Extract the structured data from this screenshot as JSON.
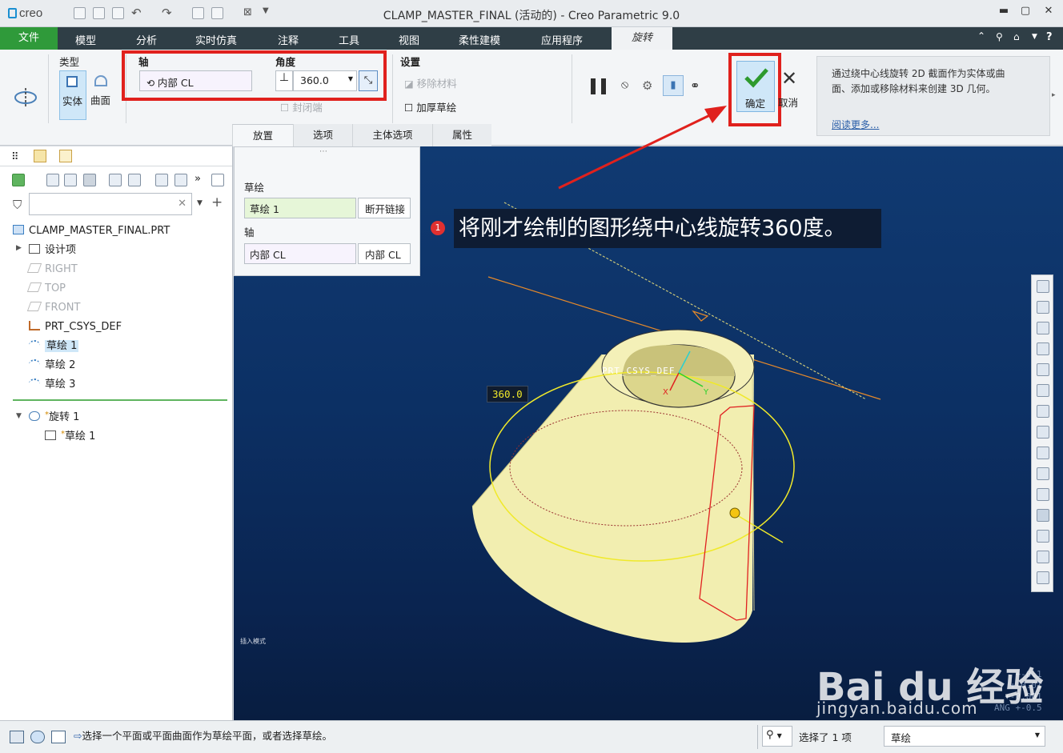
{
  "app": {
    "logo": "creo",
    "window_title": "CLAMP_MASTER_FINAL (活动的) - Creo Parametric 9.0"
  },
  "menu": {
    "file": "文件",
    "items": [
      "模型",
      "分析",
      "实时仿真",
      "注释",
      "工具",
      "视图",
      "柔性建模",
      "应用程序"
    ],
    "active": "旋转"
  },
  "ribbon": {
    "type_label": "类型",
    "type_solid": "实体",
    "type_surface": "曲面",
    "axis_label": "轴",
    "axis_value": "内部 CL",
    "angle_label": "角度",
    "angle_value": "360.0",
    "cap_ends": "封闭端",
    "settings_label": "设置",
    "remove_material": "移除材料",
    "thicken_sketch": "加厚草绘",
    "ok": "确定",
    "cancel": "取消",
    "help_text": "通过绕中心线旋转 2D 截面作为实体或曲面、添加或移除材料来创建 3D 几何。",
    "help_link": "阅读更多...",
    "tabs": [
      "放置",
      "选项",
      "主体选项",
      "属性"
    ]
  },
  "placement": {
    "sketch_label": "草绘",
    "sketch_value": "草绘 1",
    "unlink_button": "断开链接",
    "axis_label": "轴",
    "axis_value": "内部 CL",
    "axis_button": "内部 CL"
  },
  "tree": {
    "root": "CLAMP_MASTER_FINAL.PRT",
    "items": [
      "设计项",
      "RIGHT",
      "TOP",
      "FRONT",
      "PRT_CSYS_DEF",
      "草绘 1",
      "草绘 2",
      "草绘 3"
    ],
    "feature": "旋转 1",
    "feature_child": "草绘 1"
  },
  "viewport": {
    "annotation_number": "1",
    "annotation_text": "将刚才绘制的图形绕中心线旋转360度。",
    "dimension": "360.0",
    "csys_label": "PRT_CSYS_DEF",
    "axis_x": "X",
    "axis_y": "Y",
    "insert_mode": "插入模式",
    "tolerances": [
      "+-0.1",
      "+-0.01",
      "+-0.001",
      "ANG +-0.5"
    ],
    "watermark_main": "Bai du 经验",
    "watermark_url": "jingyan.baidu.com"
  },
  "status": {
    "message": "选择一个平面或平面曲面作为草绘平面，或者选择草绘。",
    "selected": "选择了 1 项",
    "filter": "草绘"
  },
  "colors": {
    "menubar": "#2f3e46",
    "file_tab": "#2f9a3a",
    "highlight_red": "#e0211d",
    "viewport_top": "#103a72",
    "part_fill": "#f2eeb0"
  }
}
